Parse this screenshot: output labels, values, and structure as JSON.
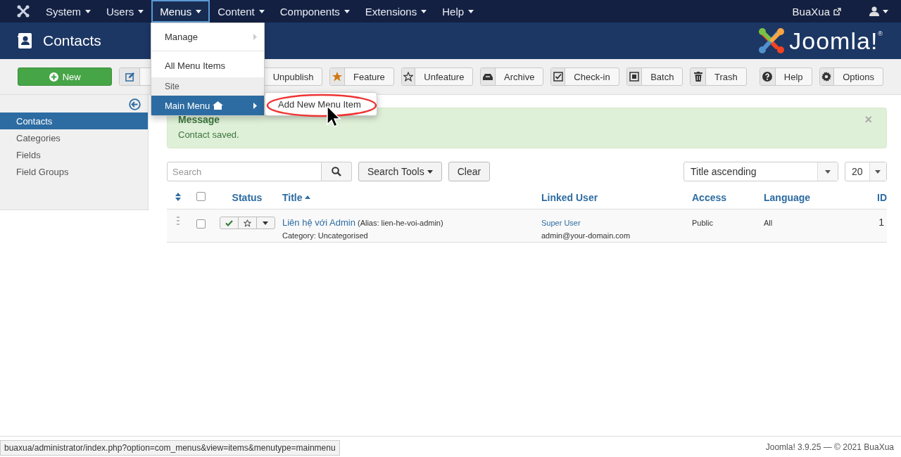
{
  "navbar": {
    "items": [
      {
        "label": "System",
        "selected": false
      },
      {
        "label": "Users",
        "selected": false
      },
      {
        "label": "Menus",
        "selected": true
      },
      {
        "label": "Content",
        "selected": false
      },
      {
        "label": "Components",
        "selected": false
      },
      {
        "label": "Extensions",
        "selected": false
      },
      {
        "label": "Help",
        "selected": false
      }
    ],
    "site_link": "BuaXua"
  },
  "header": {
    "title": "Contacts",
    "logo_text": "Joomla!",
    "logo_mark": "®"
  },
  "toolbar": [
    {
      "kind": "primary",
      "label": "New"
    },
    {
      "kind": "icon-only"
    },
    {
      "kind": "default",
      "label": "Unpublish"
    },
    {
      "kind": "default",
      "label": "Feature"
    },
    {
      "kind": "default",
      "label": "Unfeature"
    },
    {
      "kind": "default",
      "label": "Archive"
    },
    {
      "kind": "default",
      "label": "Check-in"
    },
    {
      "kind": "default",
      "label": "Batch"
    },
    {
      "kind": "default",
      "label": "Trash"
    },
    {
      "kind": "default",
      "label": "Help"
    },
    {
      "kind": "default",
      "label": "Options"
    }
  ],
  "dropdown": {
    "items": [
      {
        "kind": "item",
        "label": "Manage",
        "selected": false,
        "submenu": true
      },
      {
        "kind": "divider"
      },
      {
        "kind": "item",
        "label": "All Menu Items",
        "selected": false,
        "submenu": false
      },
      {
        "kind": "header",
        "label": "Site"
      },
      {
        "kind": "item",
        "label": "Main Menu",
        "selected": true,
        "submenu": true,
        "home": true
      }
    ],
    "submenu": [
      {
        "label": "Add New Menu Item"
      }
    ]
  },
  "sidebar": {
    "items": [
      {
        "label": "Contacts",
        "selected": true
      },
      {
        "label": "Categories",
        "selected": false
      },
      {
        "label": "Fields",
        "selected": false
      },
      {
        "label": "Field Groups",
        "selected": false
      }
    ]
  },
  "message": {
    "heading": "Message",
    "text": "Contact saved.",
    "close": "×"
  },
  "filters": {
    "search_placeholder": "Search",
    "search_tools": "Search Tools",
    "clear": "Clear",
    "ordering": "Title ascending",
    "limit": "20"
  },
  "table": {
    "columns": [
      {
        "kind": "order"
      },
      {
        "kind": "checkbox",
        "checked": false
      },
      {
        "kind": "text",
        "label": "Status",
        "sorted": false
      },
      {
        "kind": "text",
        "label": "Title",
        "sorted": true
      },
      {
        "kind": "text",
        "label": "Linked User",
        "sorted": false
      },
      {
        "kind": "text",
        "label": "Access",
        "sorted": false
      },
      {
        "kind": "text",
        "label": "Language",
        "sorted": false
      },
      {
        "kind": "text",
        "label": "ID",
        "sorted": false
      }
    ],
    "rows": [
      {
        "checked": false,
        "published": true,
        "featured": false,
        "title": "Liên hệ với Admin",
        "alias": "(Alias: lien-he-voi-admin)",
        "category": "Category: Uncategorised",
        "linked_user": "Super User",
        "email": "admin@your-domain.com",
        "access": "Public",
        "language": "All",
        "id": "1"
      }
    ]
  },
  "status_url": "buaxua/administrator/index.php?option=com_menus&view=items&menutype=mainmenu",
  "footer": "Joomla! 3.9.25 — © 2021 BuaXua"
}
